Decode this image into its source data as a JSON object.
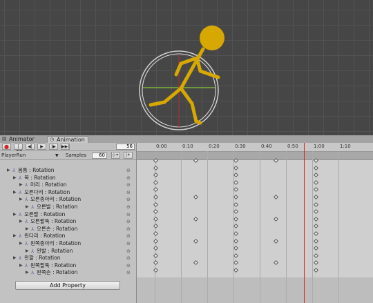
{
  "tabs": [
    {
      "label": "Animator",
      "icon": "animator-icon"
    },
    {
      "label": "Animation",
      "icon": "clock-icon"
    }
  ],
  "toolbar": {
    "frame": "56",
    "buttons": [
      "record-icon",
      "first-key-icon",
      "prev-key-icon",
      "play-icon",
      "next-key-icon",
      "last-key-icon"
    ]
  },
  "clip": {
    "name": "PlayerRun",
    "samples_label": "Samples",
    "samples_value": "60"
  },
  "timeline": {
    "ticks": [
      "0:00",
      "0:10",
      "0:20",
      "0:30",
      "0:40",
      "0:50",
      "1:00",
      "1:10"
    ],
    "playhead_color": "#e02020"
  },
  "properties": [
    {
      "label": "몸통 : Rotation",
      "depth": 0
    },
    {
      "label": "목 : Rotation",
      "depth": 1
    },
    {
      "label": "머리 : Rotation",
      "depth": 2
    },
    {
      "label": "오른다리 : Rotation",
      "depth": 1
    },
    {
      "label": "오른종아리 : Rotation",
      "depth": 2
    },
    {
      "label": "오른발 : Rotation",
      "depth": 3
    },
    {
      "label": "오른팔 : Rotation",
      "depth": 1
    },
    {
      "label": "오른팔뚝 : Rotation",
      "depth": 2
    },
    {
      "label": "오른손 : Rotation",
      "depth": 3
    },
    {
      "label": "왼다리 : Rotation",
      "depth": 1
    },
    {
      "label": "왼쪽종아리 : Rotation",
      "depth": 2
    },
    {
      "label": "왼발 : Rotation",
      "depth": 3
    },
    {
      "label": "왼팔 : Rotation",
      "depth": 1
    },
    {
      "label": "왼쪽팔뚝 : Rotation",
      "depth": 2
    },
    {
      "label": "왼쪽손 : Rotation",
      "depth": 3
    }
  ],
  "add_property_label": "Add Property"
}
